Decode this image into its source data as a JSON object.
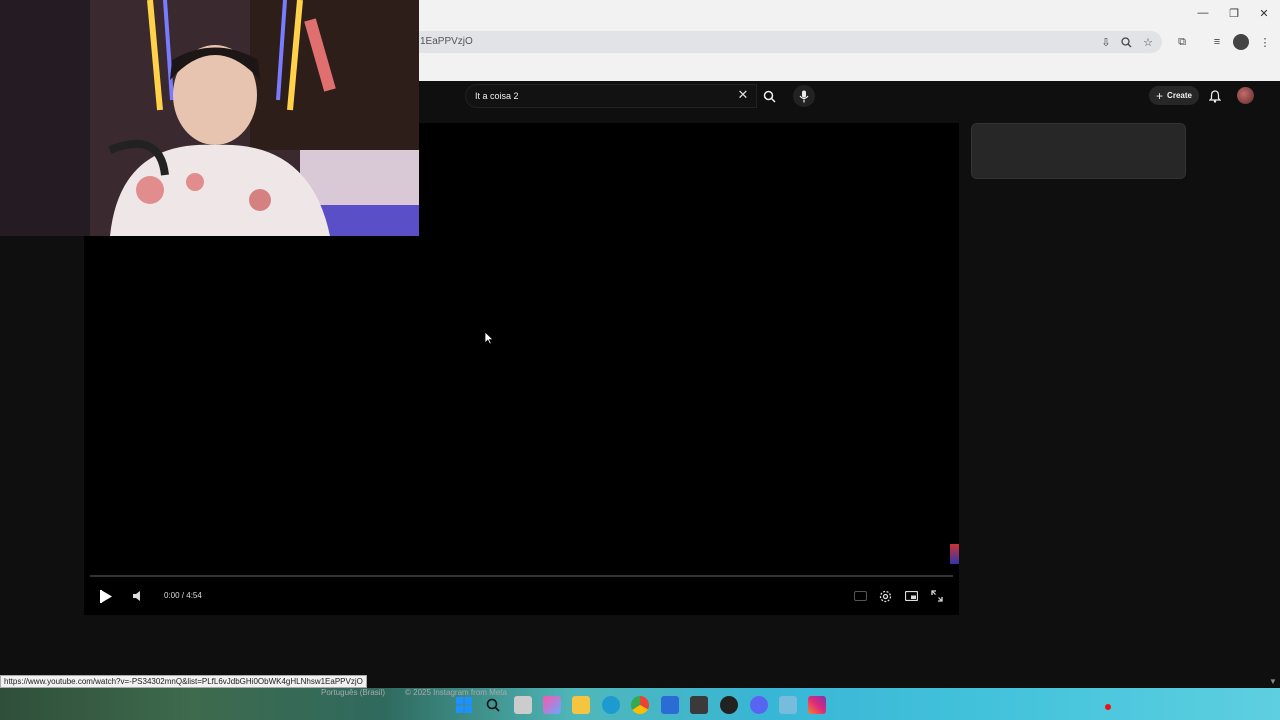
{
  "browser": {
    "address_text": "1EaPPVzjO",
    "window_controls": [
      "minimize",
      "restore",
      "close"
    ]
  },
  "youtube": {
    "search": {
      "value": "It a coisa 2"
    },
    "create_label": "Create"
  },
  "player": {
    "time": "0:00 / 4:54"
  },
  "status_url": "https://www.youtube.com/watch?v=-PS34302mnQ&list=PLfL6vJdbGHi0ObWK4gHLNhsw1EaPPVzjO",
  "footer": {
    "language": "Português (Brasil)",
    "copyright": "© 2025 Instagram from Meta"
  },
  "colors": {
    "page_bg": "#0f0f0f",
    "player_bg": "#000000",
    "chrome_bg": "#f2f2f2",
    "rec_indicator": "#e11111"
  },
  "icons": [
    "search-icon",
    "mic-icon",
    "bell-icon",
    "play-icon",
    "volume-icon",
    "captions-icon",
    "settings-icon",
    "theater-icon",
    "fullscreen-icon",
    "windows-start-icon"
  ]
}
